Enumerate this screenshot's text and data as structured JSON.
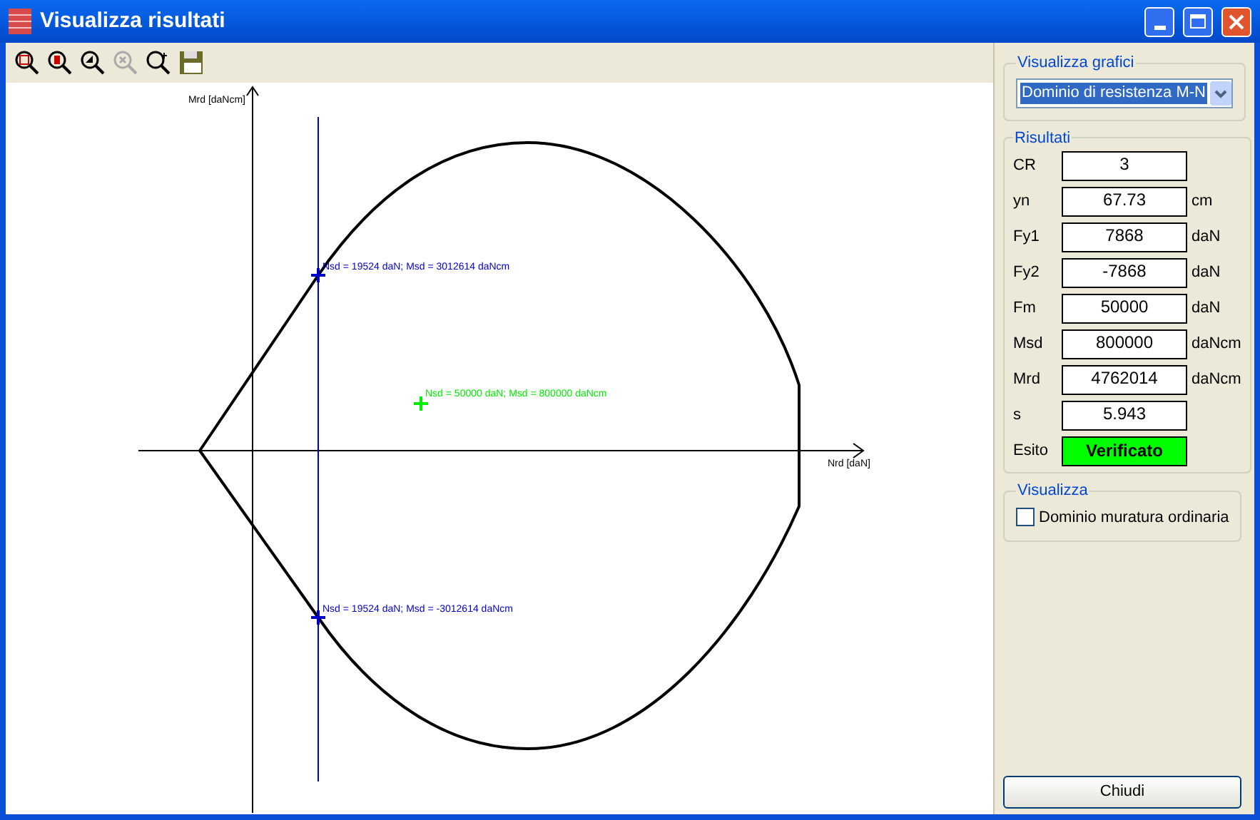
{
  "window": {
    "title": "Visualizza risultati"
  },
  "toolbar": [
    {
      "disabled": false
    },
    {
      "disabled": false
    },
    {
      "disabled": false
    },
    {
      "disabled": true
    },
    {
      "disabled": false
    },
    {
      "disabled": false
    }
  ],
  "chart": {
    "y_axis_label": "Mrd [daNcm]",
    "x_axis_label": "Nrd [daN]",
    "points": [
      {
        "label": "Nsd = 19524 daN; Msd = 3012614 daNcm",
        "color": "#0000cc"
      },
      {
        "label": "Nsd = 50000 daN; Msd = 800000 daNcm",
        "color": "#00ee00"
      },
      {
        "label": "Nsd = 19524 daN; Msd = -3012614 daNcm",
        "color": "#0000cc"
      }
    ]
  },
  "graph_group": {
    "title": "Visualizza grafici",
    "selected_graph": "Dominio di resistenza M-N"
  },
  "results": {
    "title": "Risultati",
    "rows": [
      {
        "kind": "field",
        "label": "CR",
        "value": "3"
      },
      {
        "kind": "field",
        "label": "yn",
        "value": "67.73",
        "unit": "cm"
      },
      {
        "kind": "field",
        "label": "Fy1",
        "value": "7868",
        "unit": "daN"
      },
      {
        "kind": "field",
        "label": "Fy2",
        "value": "-7868",
        "unit": "daN"
      },
      {
        "kind": "field",
        "label": "Fm",
        "value": "50000",
        "unit": "daN"
      },
      {
        "kind": "field",
        "label": "Msd",
        "value": "800000",
        "unit": "daNcm"
      },
      {
        "kind": "field",
        "label": "Mrd",
        "value": "4762014",
        "unit": "daNcm"
      },
      {
        "kind": "field",
        "label": "s",
        "value": "5.943"
      },
      {
        "kind": "status",
        "label": "Esito",
        "value": "Verificato",
        "verified": true
      }
    ]
  },
  "display_group": {
    "title": "Visualizza",
    "option": {
      "label": "Dominio muratura ordinaria",
      "checked": false
    }
  },
  "close_button": "Chiudi"
}
